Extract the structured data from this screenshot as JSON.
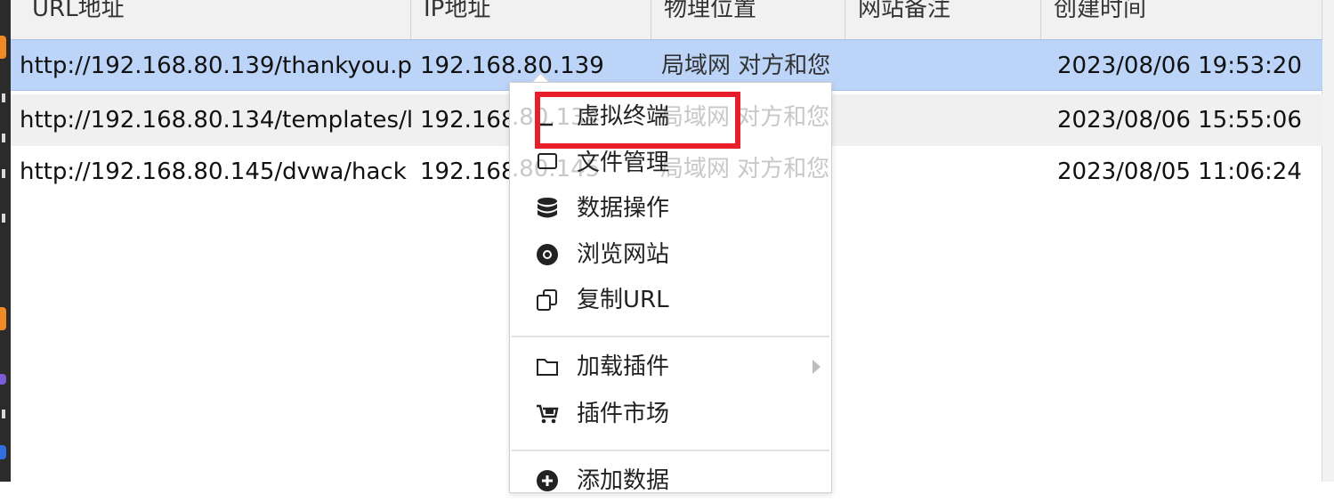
{
  "table": {
    "headers": [
      "URL地址",
      "IP地址",
      "物理位置",
      "网站备注",
      "创建时间"
    ],
    "rows": [
      {
        "url": "http://192.168.80.139/thankyou.p",
        "ip": "192.168.80.139",
        "location": "局域网 对方和您",
        "note": "",
        "created": "2023/08/06 19:53:20"
      },
      {
        "url": "http://192.168.80.134/templates/l",
        "ip": "192.168",
        "location": "局域网 对方和您",
        "note": "",
        "created": "2023/08/06 15:55:06"
      },
      {
        "url": "http://192.168.80.145/dvwa/hack",
        "ip": "192.168",
        "location": "局域网 对方和您",
        "note": "",
        "created": "2023/08/05 11:06:24"
      }
    ]
  },
  "context_menu": {
    "items": [
      {
        "label": "虚拟终端",
        "icon": "terminal-icon"
      },
      {
        "label": "文件管理",
        "icon": "folder-icon"
      },
      {
        "label": "数据操作",
        "icon": "database-icon"
      },
      {
        "label": "浏览网站",
        "icon": "chrome-icon"
      },
      {
        "label": "复制URL",
        "icon": "copy-icon"
      },
      {
        "label": "加载插件",
        "icon": "folder-outline-icon",
        "has_submenu": true
      },
      {
        "label": "插件市场",
        "icon": "cart-icon"
      },
      {
        "label": "添加数据",
        "icon": "plus-circle-icon"
      }
    ]
  },
  "ghost_text": {
    "ip_row2": ".80.134",
    "ip_row3": ".80.145"
  },
  "colors": {
    "selected_row": "#bcd4f7",
    "highlight": "#e81e2a"
  }
}
